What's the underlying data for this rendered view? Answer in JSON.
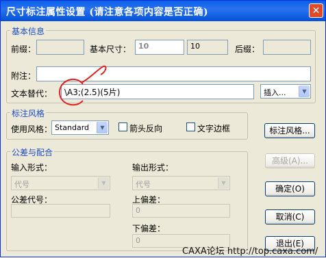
{
  "window": {
    "title": "尺寸标注属性设置 (请注意各项内容是否正确)",
    "close_glyph": "✕"
  },
  "basic": {
    "group_title": "基本信息",
    "prefix_label": "前缀：",
    "prefix_value": "",
    "basic_size_label": "基本尺寸：",
    "basic_size_value": "10",
    "basic_size_measured": "10",
    "suffix_label": "后缀：",
    "suffix_value": "",
    "note_label": "附注：",
    "note_value": "",
    "text_replace_label": "文本替代：",
    "text_replace_value": "\\A3;(2.5)(5片)",
    "insert_label": "插入..."
  },
  "style": {
    "group_title": "标注风格",
    "use_style_label": "使用风格：",
    "style_value": "Standard",
    "arrow_reverse_label": "箭头反向",
    "text_border_label": "文字边框",
    "style_button": "标注风格..."
  },
  "tolerance": {
    "group_title": "公差与配合",
    "input_form_label": "输入形式：",
    "input_form_value": "代号",
    "output_form_label": "输出形式：",
    "output_form_value": "代号",
    "tol_code_label": "公差代号：",
    "tol_code_value": "",
    "upper_dev_label": "上偏差：",
    "upper_dev_value": "0",
    "lower_dev_label": "下偏差：",
    "lower_dev_value": "0"
  },
  "buttons": {
    "advanced": "高级(A)...",
    "ok": "确定(O)",
    "cancel": "取消(C)",
    "exit": "退出(E)"
  },
  "watermark": "CAXA论坛 http://top.caxa.com/",
  "annotation_color": "#e02020"
}
